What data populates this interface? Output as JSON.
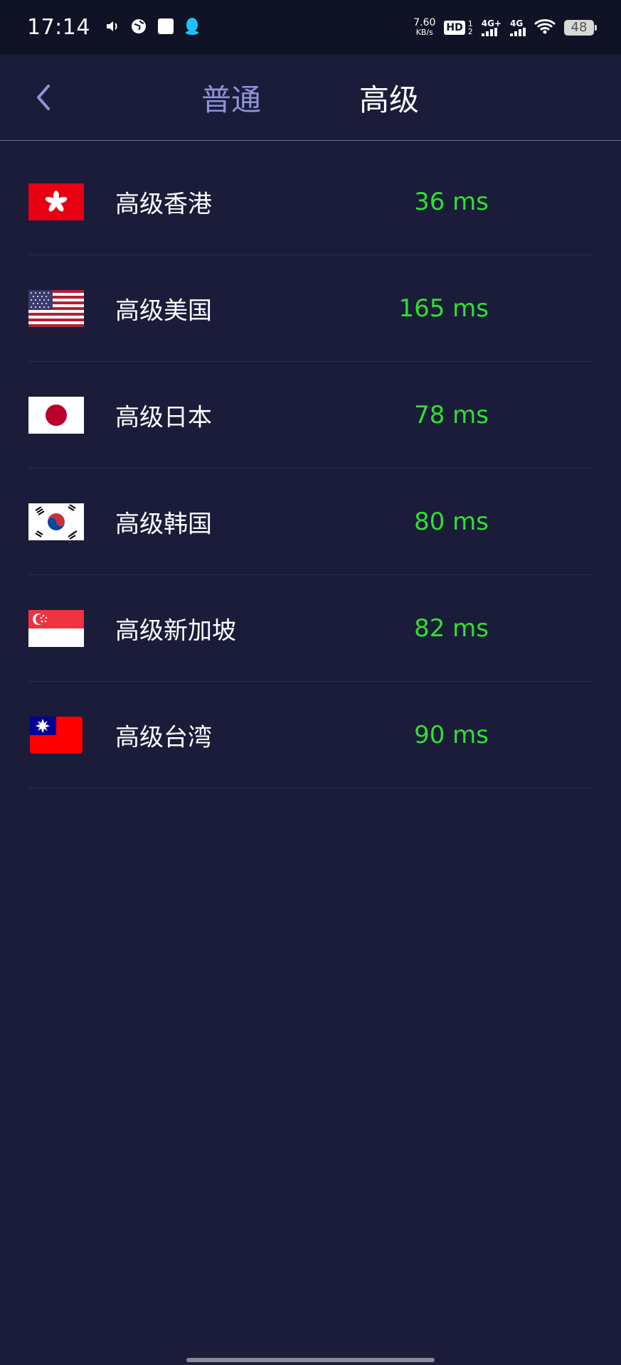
{
  "status_bar": {
    "time": "17:14",
    "net_speed_value": "7.60",
    "net_speed_unit": "KB/s",
    "hd_label": "HD",
    "hd_sub_top": "1",
    "hd_sub_bottom": "2",
    "signal1": "4G+",
    "signal2": "4G",
    "battery": "48",
    "icons": [
      "volume-icon",
      "browser-icon",
      "square-app-icon",
      "qq-penguin-icon",
      "wifi-icon"
    ]
  },
  "header": {
    "tabs": [
      {
        "label": "普通",
        "active": false
      },
      {
        "label": "高级",
        "active": true
      }
    ]
  },
  "servers": [
    {
      "name": "高级香港",
      "latency": "36 ms",
      "flag": "hong-kong-flag"
    },
    {
      "name": "高级美国",
      "latency": "165 ms",
      "flag": "usa-flag"
    },
    {
      "name": "高级日本",
      "latency": "78 ms",
      "flag": "japan-flag"
    },
    {
      "name": "高级韩国",
      "latency": "80 ms",
      "flag": "korea-flag"
    },
    {
      "name": "高级新加坡",
      "latency": "82 ms",
      "flag": "singapore-flag"
    },
    {
      "name": "高级台湾",
      "latency": "90 ms",
      "flag": "taiwan-flag"
    }
  ],
  "colors": {
    "background": "#1a1c3a",
    "status_bar": "#101226",
    "latency": "#2fe02f",
    "inactive_tab": "#8f93d6"
  }
}
